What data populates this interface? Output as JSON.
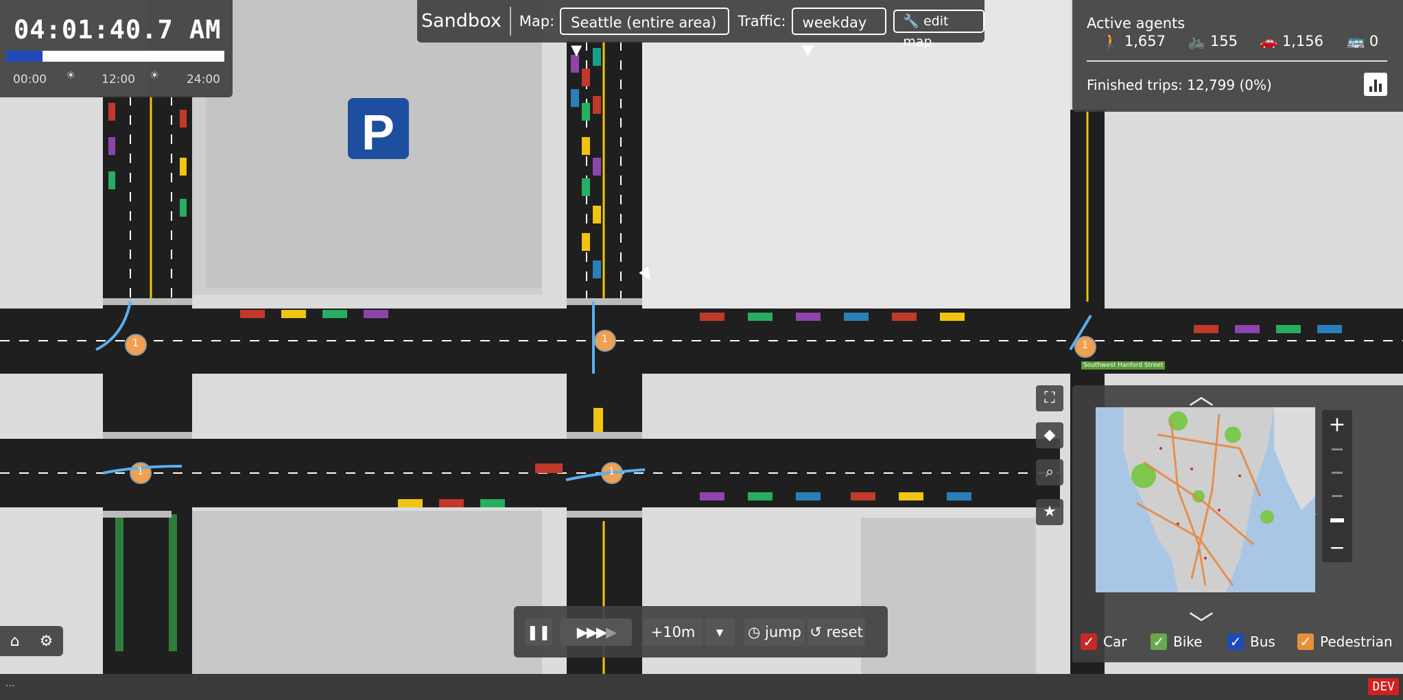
{
  "clock": {
    "time": "04:01:40.7 AM",
    "progress": 0.167,
    "labels": [
      "00:00",
      "12:00",
      "24:00"
    ]
  },
  "topbar": {
    "title": "Sandbox",
    "map_label": "Map:",
    "map_value": "Seattle (entire area)",
    "traffic_label": "Traffic:",
    "traffic_value": "weekday",
    "edit_map": "edit map"
  },
  "agents": {
    "title": "Active agents",
    "pedestrians": "1,657",
    "bikes": "155",
    "cars": "1,156",
    "buses": "0",
    "finished": "Finished trips: 12,799 (0%)"
  },
  "legend": {
    "car": "Car",
    "bike": "Bike",
    "bus": "Bus",
    "pedestrian": "Pedestrian",
    "car_color": "#c62828",
    "bike_color": "#6aa84f",
    "bus_color": "#1f4ab8",
    "pedestrian_color": "#e69138"
  },
  "speed": {
    "step": "+10m",
    "jump": "jump",
    "reset": "reset"
  },
  "intersection_label": "1",
  "street_label": "Southwest Hanford Street",
  "dev_badge": "DEV",
  "status_dots": "..."
}
